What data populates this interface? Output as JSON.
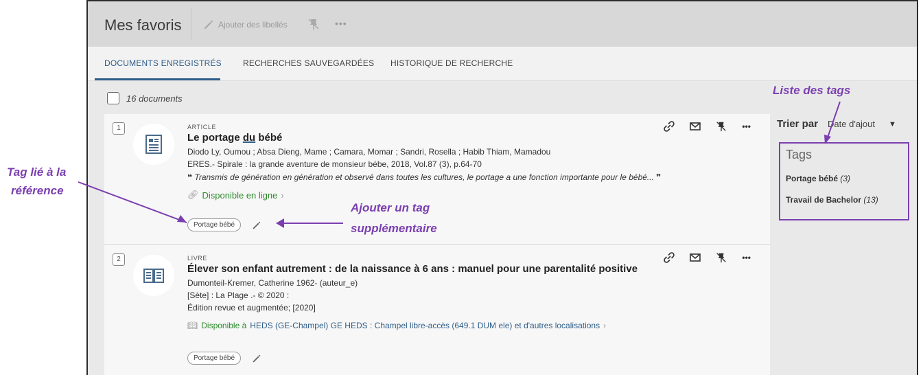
{
  "header": {
    "title": "Mes favoris",
    "add_labels": "Ajouter des libellés",
    "more": "•••"
  },
  "tabs": [
    {
      "label": "DOCUMENTS ENREGISTRÉS",
      "active": true
    },
    {
      "label": "RECHERCHES SAUVEGARDÉES",
      "active": false
    },
    {
      "label": "HISTORIQUE DE RECHERCHE",
      "active": false
    }
  ],
  "toolbar": {
    "count": "16 documents"
  },
  "items": [
    {
      "num": "1",
      "type": "ARTICLE",
      "title_pre": "Le portage ",
      "title_u": "du",
      "title_post": " bébé",
      "authors": "Diodo Ly, Oumou ; Absa Dieng, Mame ; Camara, Momar ; Sandri, Rosella ; Habib Thiam, Mamadou",
      "source": "ERES.- Spirale : la grande aventure de monsieur bébe, 2018, Vol.87 (3), p.64-70",
      "quote": "Transmis de génération en génération et observé dans toutes les cultures, le portage a une fonction importante pour le bébé...",
      "availability": "Disponible en ligne",
      "tag": "Portage bébé"
    },
    {
      "num": "2",
      "type": "LIVRE",
      "title": "Élever son enfant autrement : de la naissance à 6 ans : manuel pour une parentalité positive",
      "author": "Dumonteil-Kremer, Catherine 1962- (auteur_e)",
      "publisher": "[Sète] : La Plage .- © 2020 :",
      "edition": "Édition revue et augmentée; [2020]",
      "availability_prefix": "Disponible à",
      "availability_location": "HEDS (GE-Champel)  GE HEDS : Champel libre-accès (649.1 DUM ele) et d'autres localisations",
      "tag": "Portage bébé"
    }
  ],
  "sidebar": {
    "sort_label": "Trier par",
    "sort_value": "Date d'ajout",
    "tags_heading": "Tags",
    "tags": [
      {
        "name": "Portage bébé",
        "count": "(3)"
      },
      {
        "name": "Travail de Bachelor",
        "count": "(13)"
      }
    ]
  },
  "annotations": {
    "tag_linked_line1": "Tag lié à la",
    "tag_linked_line2": "référence",
    "add_tag_line1": "Ajouter un tag",
    "add_tag_line2": "supplémentaire",
    "tag_list": "Liste des tags"
  },
  "colors": {
    "annotation": "#7b3fb0",
    "accent": "#2f5f8a",
    "available": "#2e8b2e"
  },
  "icons": [
    "pencil-icon",
    "unpin-icon",
    "link-icon",
    "email-icon",
    "more-icon",
    "document-icon",
    "book-icon",
    "quote-icon",
    "chevron-right-icon",
    "dropdown-arrow-icon"
  ]
}
